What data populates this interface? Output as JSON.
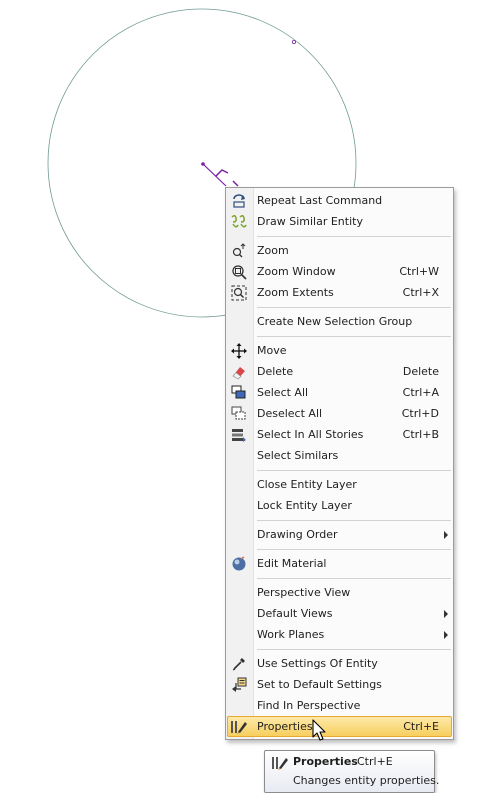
{
  "menu": {
    "items": [
      {
        "type": "item",
        "label": "Repeat Last Command",
        "shortcut": "",
        "submenu": false,
        "icon": "repeat-command-icon"
      },
      {
        "type": "item",
        "label": "Draw Similar Entity",
        "shortcut": "",
        "submenu": false,
        "icon": "draw-similar-icon"
      },
      {
        "type": "separator"
      },
      {
        "type": "item",
        "label": "Zoom",
        "shortcut": "",
        "submenu": false,
        "icon": "zoom-icon"
      },
      {
        "type": "item",
        "label": "Zoom Window",
        "shortcut": "Ctrl+W",
        "submenu": false,
        "icon": "zoom-window-icon"
      },
      {
        "type": "item",
        "label": "Zoom Extents",
        "shortcut": "Ctrl+X",
        "submenu": false,
        "icon": "zoom-extents-icon"
      },
      {
        "type": "separator"
      },
      {
        "type": "item",
        "label": "Create New Selection Group",
        "shortcut": "",
        "submenu": false,
        "icon": ""
      },
      {
        "type": "separator"
      },
      {
        "type": "item",
        "label": "Move",
        "shortcut": "",
        "submenu": false,
        "icon": "move-icon"
      },
      {
        "type": "item",
        "label": "Delete",
        "shortcut": "Delete",
        "submenu": false,
        "icon": "eraser-icon"
      },
      {
        "type": "item",
        "label": "Select All",
        "shortcut": "Ctrl+A",
        "submenu": false,
        "icon": "select-all-icon"
      },
      {
        "type": "item",
        "label": "Deselect All",
        "shortcut": "Ctrl+D",
        "submenu": false,
        "icon": "deselect-all-icon"
      },
      {
        "type": "item",
        "label": "Select In All Stories",
        "shortcut": "Ctrl+B",
        "submenu": false,
        "icon": "select-stories-icon"
      },
      {
        "type": "item",
        "label": "Select Similars",
        "shortcut": "",
        "submenu": false,
        "icon": ""
      },
      {
        "type": "separator"
      },
      {
        "type": "item",
        "label": "Close Entity Layer",
        "shortcut": "",
        "submenu": false,
        "icon": ""
      },
      {
        "type": "item",
        "label": "Lock Entity Layer",
        "shortcut": "",
        "submenu": false,
        "icon": ""
      },
      {
        "type": "separator"
      },
      {
        "type": "item",
        "label": "Drawing Order",
        "shortcut": "",
        "submenu": true,
        "icon": ""
      },
      {
        "type": "separator"
      },
      {
        "type": "item",
        "label": "Edit Material",
        "shortcut": "",
        "submenu": false,
        "icon": "material-sphere-icon"
      },
      {
        "type": "separator"
      },
      {
        "type": "item",
        "label": "Perspective View",
        "shortcut": "",
        "submenu": false,
        "icon": ""
      },
      {
        "type": "item",
        "label": "Default Views",
        "shortcut": "",
        "submenu": true,
        "icon": ""
      },
      {
        "type": "item",
        "label": "Work Planes",
        "shortcut": "",
        "submenu": true,
        "icon": ""
      },
      {
        "type": "separator"
      },
      {
        "type": "item",
        "label": "Use Settings Of Entity",
        "shortcut": "",
        "submenu": false,
        "icon": "eyedropper-icon"
      },
      {
        "type": "item",
        "label": "Set to Default Settings",
        "shortcut": "",
        "submenu": false,
        "icon": "default-settings-icon"
      },
      {
        "type": "item",
        "label": "Find In Perspective",
        "shortcut": "",
        "submenu": false,
        "icon": ""
      },
      {
        "type": "item",
        "label": "Properties",
        "shortcut": "Ctrl+E",
        "submenu": false,
        "icon": "properties-icon",
        "highlighted": true
      }
    ]
  },
  "tooltip": {
    "title": "Properties",
    "shortcut": "Ctrl+E",
    "description": "Changes entity properties."
  },
  "colors": {
    "circle": "#5f8f8a",
    "entity_purple": "#7a1fa6",
    "highlight": "#f9d46d"
  }
}
